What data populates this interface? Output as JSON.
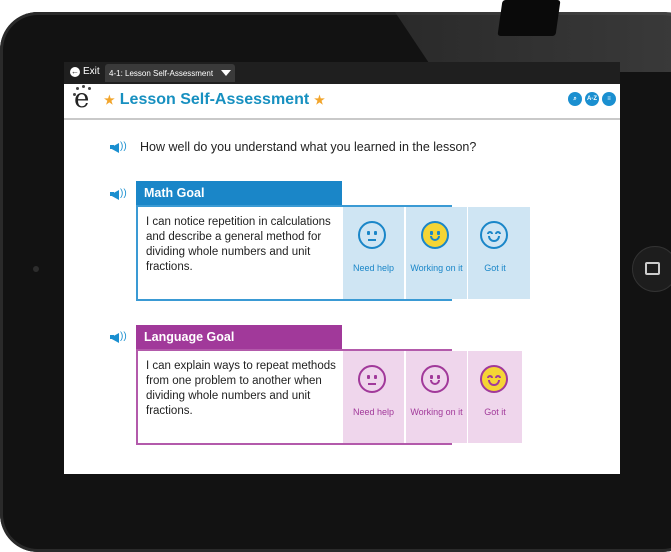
{
  "topbar": {
    "exit_label": "Exit",
    "lesson_dropdown": "4-1: Lesson Self-Assessment"
  },
  "header": {
    "title": "Lesson Self-Assessment",
    "icons": [
      "search-icon",
      "glossary-icon",
      "menu-icon"
    ]
  },
  "question": "How well do you understand what you learned in the lesson?",
  "goals": [
    {
      "title": "Math Goal",
      "text": "I can notice repetition in calculations and describe a general method for dividing whole numbers and unit fractions.",
      "options": [
        "Need help",
        "Working on it",
        "Got it"
      ],
      "selected": "Working on it",
      "color": "#1a86c8"
    },
    {
      "title": "Language Goal",
      "text": "I can explain ways to repeat methods from one problem to another when dividing whole numbers and unit fractions.",
      "options": [
        "Need help",
        "Working on it",
        "Got it"
      ],
      "selected": "Got it",
      "color": "#a1399a"
    }
  ],
  "colors": {
    "accent": "#1a86c8",
    "language": "#a1399a",
    "selected_face": "#f5d535",
    "star": "#f2a52c"
  }
}
